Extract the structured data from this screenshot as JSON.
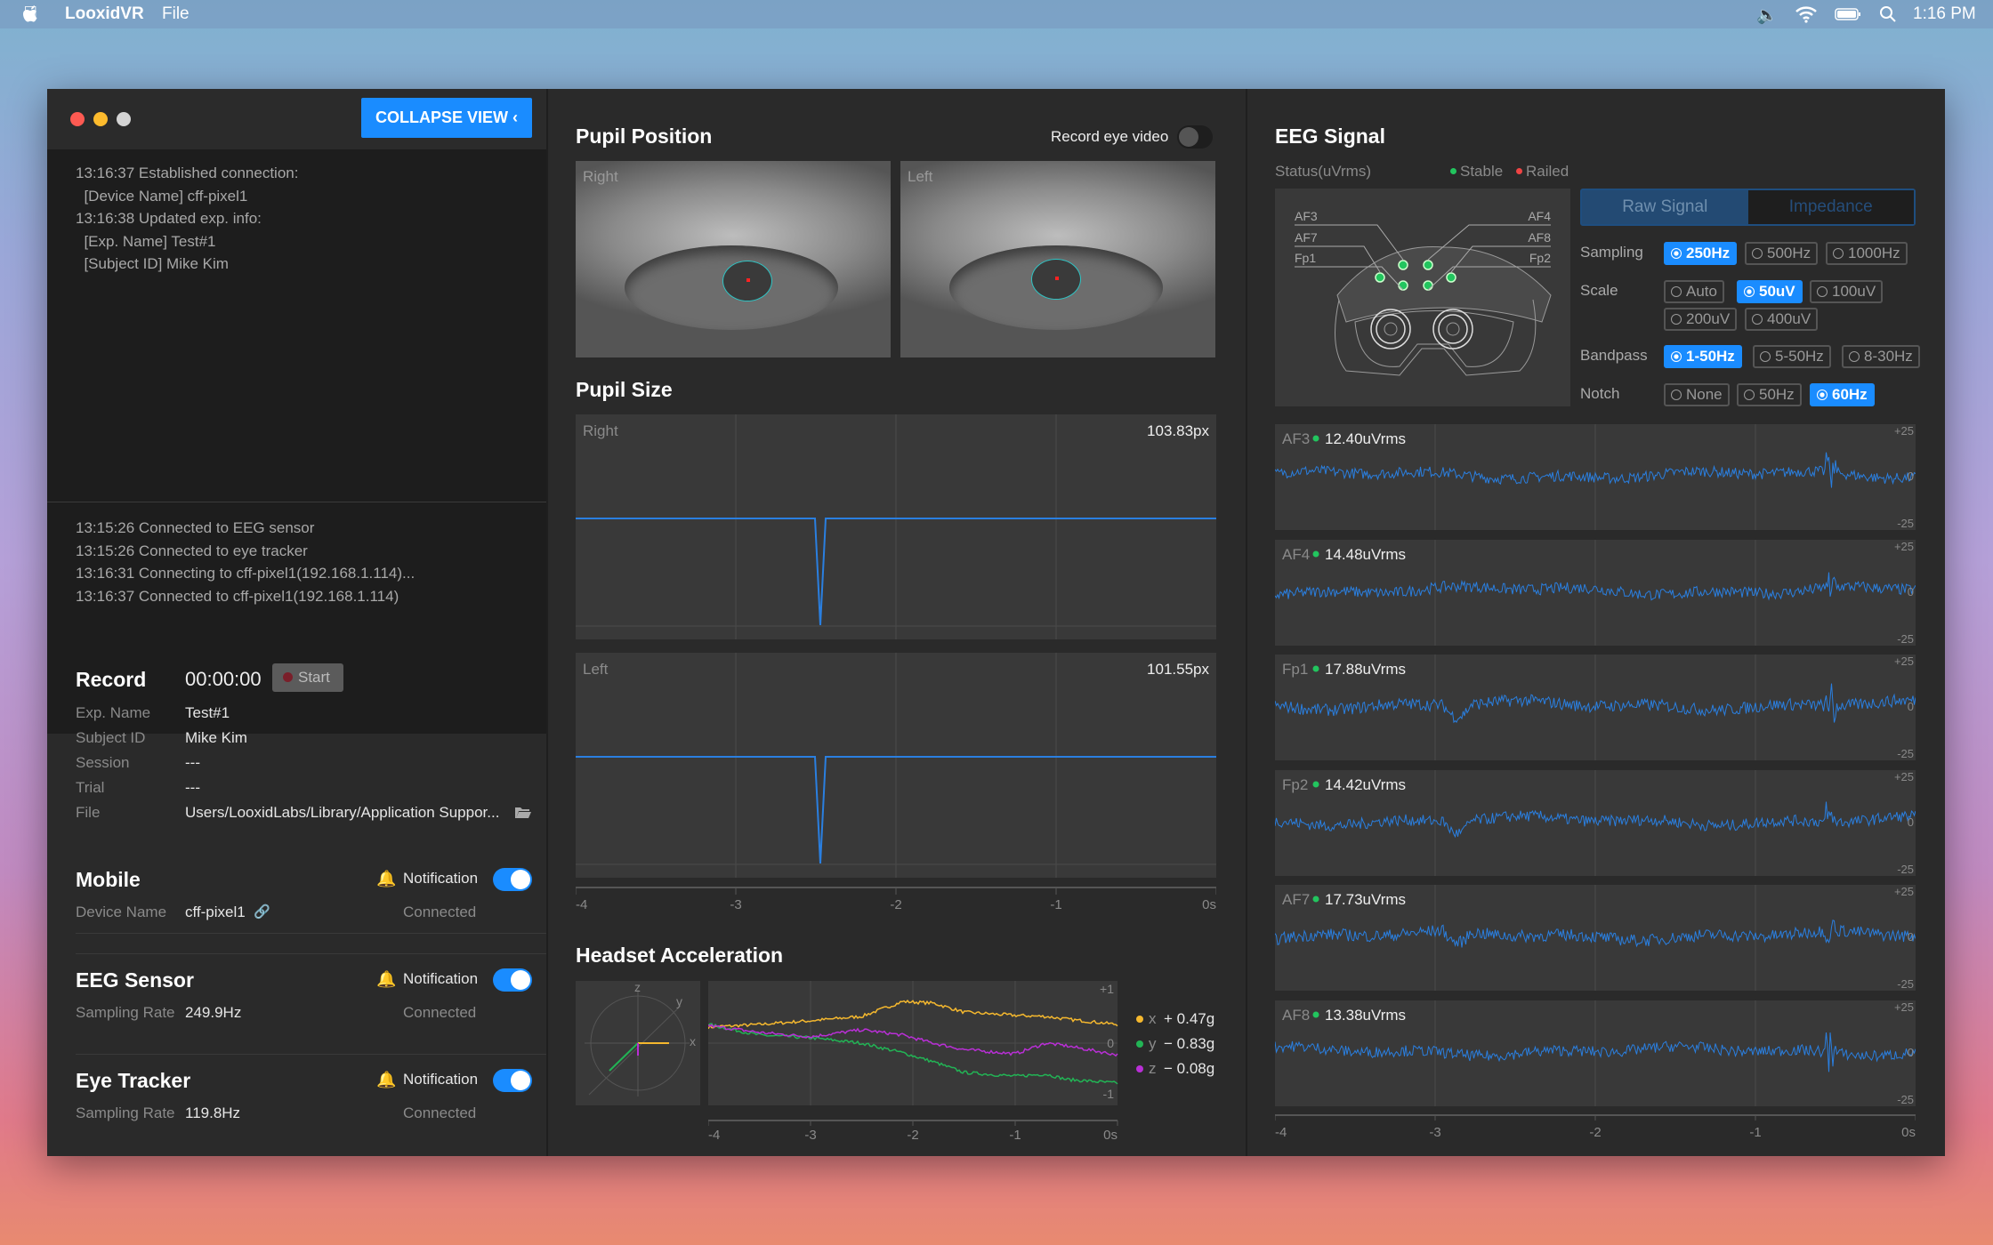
{
  "menubar": {
    "app": "LooxidVR",
    "menu_file": "File",
    "clock": "1:16 PM"
  },
  "window": {
    "collapse_label": "COLLAPSE VIEW"
  },
  "log_top": [
    "13:16:37 Established connection:",
    "  [Device Name] cff-pixel1",
    "13:16:38 Updated exp. info:",
    "  [Exp. Name] Test#1",
    "  [Subject ID] Mike Kim"
  ],
  "log_bottom": [
    "13:15:26 Connected to EEG sensor",
    "13:15:26 Connected to eye tracker",
    "13:16:31 Connecting to cff-pixel1(192.168.1.114)...",
    "13:16:37 Connected to cff-pixel1(192.168.1.114)"
  ],
  "record": {
    "title": "Record",
    "timer": "00:00:00",
    "start_label": "Start",
    "fields": [
      {
        "label": "Exp. Name",
        "value": "Test#1"
      },
      {
        "label": "Subject ID",
        "value": "Mike Kim"
      },
      {
        "label": "Session",
        "value": "---"
      },
      {
        "label": "Trial",
        "value": "---"
      },
      {
        "label": "File",
        "value": "Users/LooxidLabs/Library/Application Suppor..."
      }
    ]
  },
  "devices": [
    {
      "title": "Mobile",
      "notif": "Notification",
      "label": "Device Name",
      "value": "cff-pixel1",
      "status": "Connected",
      "notif_on": true
    },
    {
      "title": "EEG Sensor",
      "notif": "Notification",
      "label": "Sampling Rate",
      "value": "249.9Hz",
      "status": "Connected",
      "notif_on": true
    },
    {
      "title": "Eye Tracker",
      "notif": "Notification",
      "label": "Sampling Rate",
      "value": "119.8Hz",
      "status": "Connected",
      "notif_on": true
    }
  ],
  "pupil_position": {
    "title": "Pupil Position",
    "record_label": "Record eye video",
    "record_on": false,
    "right": "Right",
    "left": "Left"
  },
  "pupil_size": {
    "title": "Pupil Size",
    "right_label": "Right",
    "right_value": "103.83px",
    "left_label": "Left",
    "left_value": "101.55px",
    "ticks": [
      "-4",
      "-3",
      "-2",
      "-1",
      "0s"
    ]
  },
  "accel": {
    "title": "Headset Acceleration",
    "axes": {
      "x": "x",
      "y": "y",
      "z": "z"
    },
    "yticks": [
      "+1",
      "0",
      "-1"
    ],
    "ticks": [
      "-4",
      "-3",
      "-2",
      "-1",
      "0s"
    ],
    "legend": [
      {
        "name": "x",
        "value": "+ 0.47g",
        "color": "#f5b82e"
      },
      {
        "name": "y",
        "value": "− 0.83g",
        "color": "#22b455"
      },
      {
        "name": "z",
        "value": "− 0.08g",
        "color": "#b92fd6"
      }
    ]
  },
  "eeg": {
    "title": "EEG Signal",
    "status_label": "Status(uVrms)",
    "stable": "Stable",
    "railed": "Railed",
    "electrodes": [
      "AF3",
      "AF4",
      "AF7",
      "AF8",
      "Fp1",
      "Fp2"
    ],
    "tabs": [
      "Raw Signal",
      "Impedance"
    ],
    "sampling": {
      "label": "Sampling",
      "options": [
        "250Hz",
        "500Hz",
        "1000Hz"
      ],
      "selected": 0
    },
    "scale": {
      "label": "Scale",
      "options": [
        "Auto",
        "50uV",
        "100uV",
        "200uV",
        "400uV"
      ],
      "selected": 1
    },
    "bandpass": {
      "label": "Bandpass",
      "options": [
        "1-50Hz",
        "5-50Hz",
        "8-30Hz"
      ],
      "selected": 0
    },
    "notch": {
      "label": "Notch",
      "options": [
        "None",
        "50Hz",
        "60Hz"
      ],
      "selected": 2
    },
    "channels": [
      {
        "name": "AF3",
        "value": "12.40uVrms"
      },
      {
        "name": "AF4",
        "value": "14.48uVrms"
      },
      {
        "name": "Fp1",
        "value": "17.88uVrms"
      },
      {
        "name": "Fp2",
        "value": "14.42uVrms"
      },
      {
        "name": "AF7",
        "value": "17.73uVrms"
      },
      {
        "name": "AF8",
        "value": "13.38uVrms"
      }
    ],
    "yticks": [
      "+25",
      "0",
      "-25"
    ],
    "ticks": [
      "-4",
      "-3",
      "-2",
      "-1",
      "0s"
    ]
  },
  "chart_data": [
    {
      "type": "line",
      "title": "Pupil Size",
      "x_range": [
        -4,
        0
      ],
      "series": [
        {
          "name": "Right",
          "baseline": 103.83,
          "dip_at_s": -2.5
        },
        {
          "name": "Left",
          "baseline": 101.55,
          "dip_at_s": -2.5
        }
      ]
    },
    {
      "type": "line",
      "title": "Headset Acceleration",
      "ylim": [
        -1,
        1
      ],
      "x": [
        -4,
        -3.5,
        -3,
        -2.5,
        -2.1,
        -1.8,
        -1.5,
        -1,
        -0.7,
        -0.5,
        0
      ],
      "series": [
        {
          "name": "x",
          "values": [
            0.3,
            0.35,
            0.42,
            0.5,
            0.78,
            0.75,
            0.58,
            0.52,
            0.5,
            0.45,
            0.35
          ]
        },
        {
          "name": "y",
          "values": [
            0.35,
            0.15,
            0.1,
            0.0,
            -0.18,
            -0.35,
            -0.55,
            -0.62,
            -0.58,
            -0.68,
            -0.75
          ]
        },
        {
          "name": "z",
          "values": [
            0.33,
            0.2,
            0.12,
            0.25,
            0.15,
            0.0,
            -0.12,
            -0.2,
            0.0,
            -0.05,
            -0.22
          ]
        }
      ]
    },
    {
      "type": "line",
      "title": "EEG Signal",
      "ylim": [
        -25,
        25
      ],
      "x_range": [
        -4,
        0
      ]
    }
  ]
}
